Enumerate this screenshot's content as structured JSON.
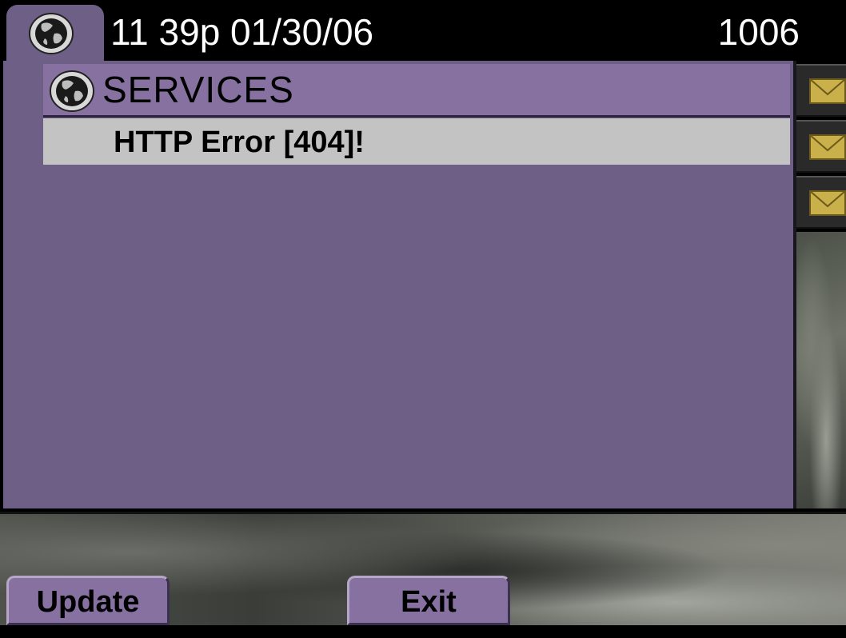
{
  "status_bar": {
    "time_date": "11 39p 01/30/06",
    "extension": "1006",
    "icon": "globe-icon"
  },
  "services_panel": {
    "title": "SERVICES",
    "icon": "globe-icon",
    "items": [
      {
        "label": "HTTP Error [404]!"
      }
    ]
  },
  "line_buttons": [
    {
      "icon": "envelope-icon"
    },
    {
      "icon": "envelope-icon"
    },
    {
      "icon": "envelope-icon"
    }
  ],
  "softkeys": {
    "update_label": "Update",
    "exit_label": "Exit"
  },
  "colors": {
    "panel_bg": "#6d5f86",
    "header_bg": "#8771a1",
    "selected_row_bg": "#c3c3c3",
    "envelope": "#c9b04a"
  }
}
